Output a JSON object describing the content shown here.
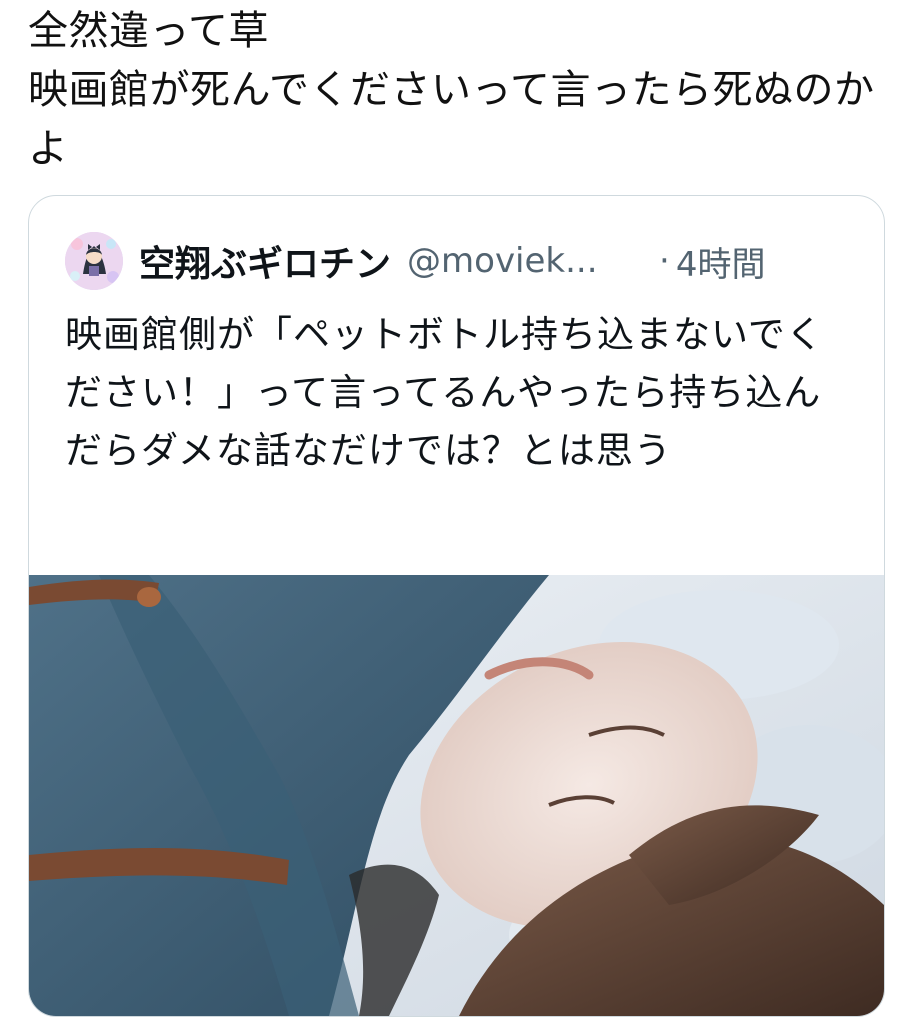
{
  "tweet": {
    "text": "全然違って草\n映画館が死んでくださいって言ったら死ぬのかよ"
  },
  "quote": {
    "display_name": "空翔ぶギロチン",
    "handle": "@moviek...",
    "separator": "·",
    "time": "4時間",
    "text": "映画館側が「ペットボトル持ち込まないでください！」って言ってるんやったら持ち込んだらダメな話なだけでは？とは思う"
  },
  "icons": {
    "avatar": "avatar-illustration",
    "photo": "quoted-photo"
  }
}
